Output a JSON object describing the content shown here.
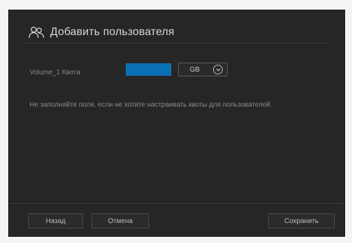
{
  "dialog": {
    "title": "Добавить пользователя",
    "header_icon": "users-icon"
  },
  "quota": {
    "label": "Volume_1 Квота",
    "value": "",
    "unit": "GB",
    "unit_dropdown_icon": "chevron-down-icon"
  },
  "hint": "Не заполняйте поля, если не хотите настраивать квоты для пользователей.",
  "footer": {
    "back_label": "Назад",
    "cancel_label": "Отмена",
    "save_label": "Сохранить"
  },
  "colors": {
    "dialog_bg": "#262626",
    "accent": "#0a6fb5",
    "text": "#d8d8d8",
    "muted_text": "#8a8a8a"
  }
}
